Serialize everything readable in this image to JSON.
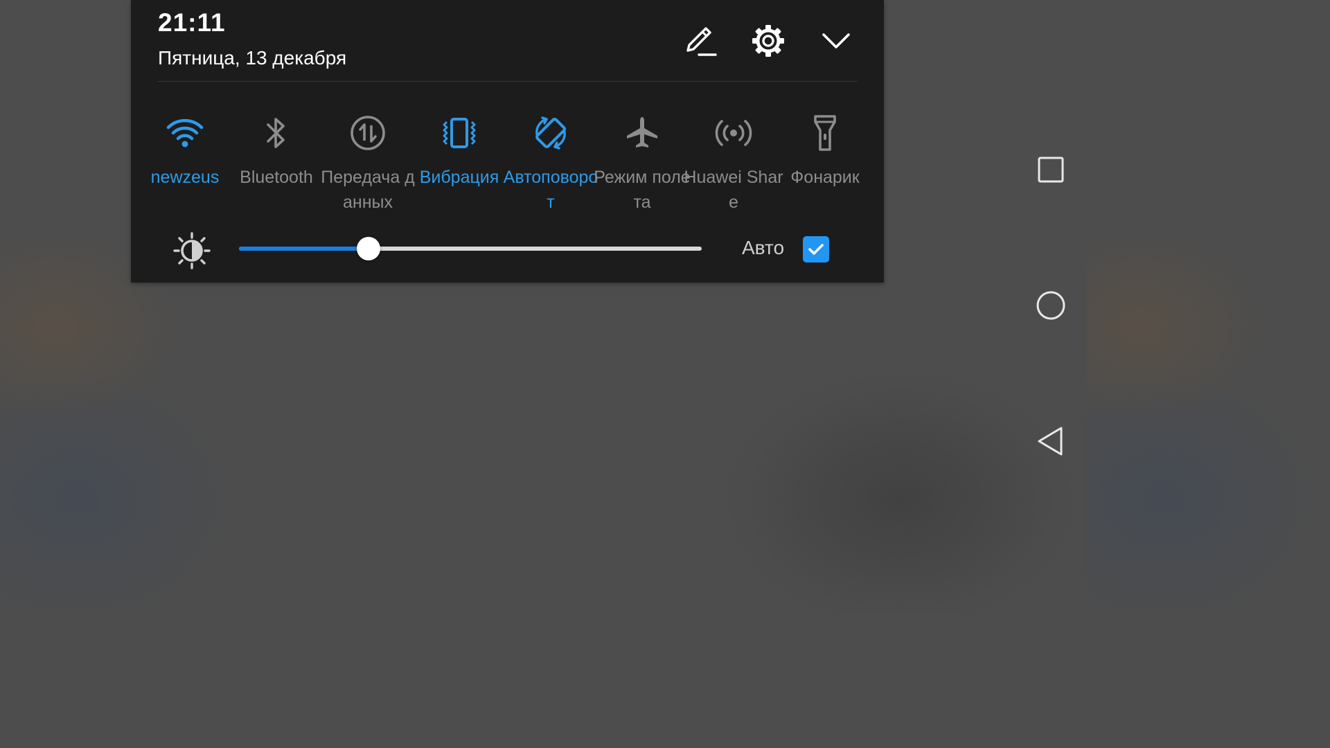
{
  "status": {
    "time": "21:11",
    "date": "Пятница, 13 декабря"
  },
  "header_actions": [
    {
      "name": "edit",
      "icon": "pencil-icon"
    },
    {
      "name": "settings",
      "icon": "gear-icon"
    },
    {
      "name": "collapse",
      "icon": "chevron-down-icon"
    }
  ],
  "toggles": [
    {
      "label": "newzeus",
      "icon": "wifi-icon",
      "active": true
    },
    {
      "label": "Bluetooth",
      "icon": "bluetooth-icon",
      "active": false
    },
    {
      "label": "Передача данных",
      "icon": "mobile-data-icon",
      "active": false
    },
    {
      "label": "Вибрация",
      "icon": "vibration-icon",
      "active": true
    },
    {
      "label": "Автоповорот",
      "icon": "auto-rotate-icon",
      "active": true
    },
    {
      "label": "Режим полета",
      "icon": "airplane-icon",
      "active": false
    },
    {
      "label": "Huawei Share",
      "icon": "huawei-share-icon",
      "active": false
    },
    {
      "label": "Фонарик",
      "icon": "flashlight-icon",
      "active": false
    }
  ],
  "brightness": {
    "level_percent": 28,
    "auto_label": "Авто",
    "auto_enabled": true
  },
  "navigation": [
    {
      "name": "recents",
      "icon": "square-icon"
    },
    {
      "name": "home",
      "icon": "circle-icon"
    },
    {
      "name": "back",
      "icon": "triangle-back-icon"
    }
  ],
  "colors": {
    "panel_background": "#1c1c1c",
    "accent_active": "#2d9bea",
    "inactive": "#8d8d8d",
    "slider_fill": "#1a7de0",
    "checkbox": "#2196f3",
    "backdrop": "#4d4d4d"
  }
}
